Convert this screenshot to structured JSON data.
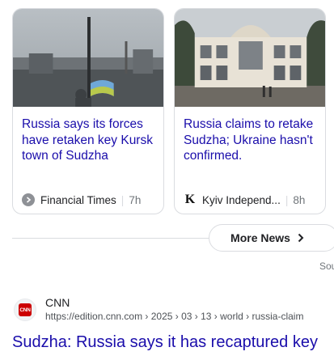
{
  "cards": [
    {
      "headline": "Russia says its forces have retaken key Kursk town of Sudzha",
      "source": "Financial Times",
      "time": "7h"
    },
    {
      "headline": "Russia claims to retake Sudzha; Ukraine hasn't confirmed.",
      "source": "Kyiv Independ...",
      "time": "8h"
    }
  ],
  "more_news": {
    "label": "More News"
  },
  "sources_label": "Sou",
  "result": {
    "site_name": "CNN",
    "logo_text": "CNN",
    "url": "https://edition.cnn.com › 2025 › 03 › 13 › world › russia-claim",
    "title": "Sudzha: Russia says it has recaptured key"
  },
  "colors": {
    "link": "#1a0dab",
    "border": "#dadce0",
    "cnn_red": "#cc0000"
  },
  "icons": {
    "ft": "financial-times-icon",
    "kyiv": "kyiv-independent-icon",
    "chevron": "chevron-right-icon",
    "cnn": "cnn-favicon"
  }
}
